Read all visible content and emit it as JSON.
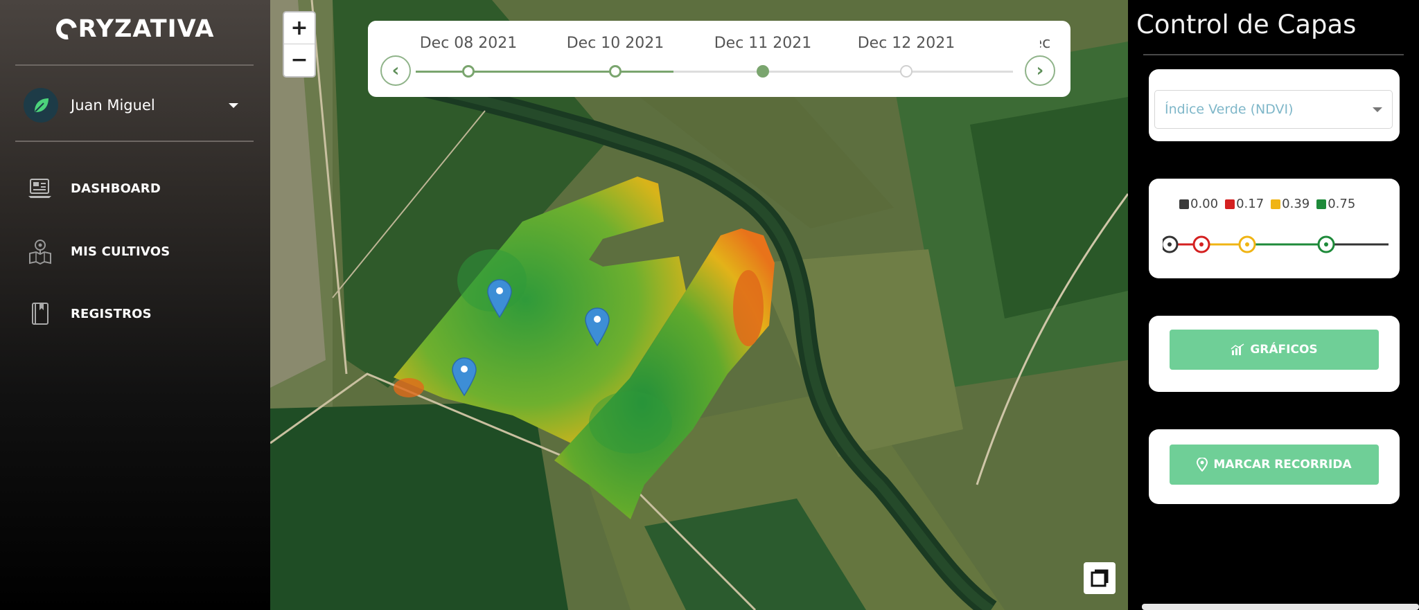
{
  "brand": {
    "logo_text": "RYZATIVA"
  },
  "user": {
    "name": "Juan Miguel"
  },
  "nav": {
    "items": [
      {
        "label": "DASHBOARD",
        "icon": "dashboard-icon"
      },
      {
        "label": "MIS CULTIVOS",
        "icon": "field-map-icon"
      },
      {
        "label": "REGISTROS",
        "icon": "book-icon"
      }
    ]
  },
  "map": {
    "zoom_in": "+",
    "zoom_out": "−",
    "timeline": {
      "dates": [
        "Dec 08 2021",
        "Dec 10 2021",
        "Dec 11 2021",
        "Dec 12 2021",
        "Dec"
      ],
      "selected": "Dec 11 2021",
      "prev": "‹",
      "next": "›"
    },
    "markers": 3
  },
  "panel": {
    "title": "Control de Capas",
    "layer_select": {
      "value": "Índice Verde (NDVI)"
    },
    "legend": [
      {
        "value": "0.00",
        "color": "#3a3a3a"
      },
      {
        "value": "0.17",
        "color": "#d42020"
      },
      {
        "value": "0.39",
        "color": "#f0b414"
      },
      {
        "value": "0.75",
        "color": "#1e8a3a"
      }
    ],
    "charts_button": "GRÁFICOS",
    "route_button": "MARCAR RECORRIDA"
  },
  "colors": {
    "accent": "#6fcf97",
    "timeline": "#7aa56e"
  }
}
